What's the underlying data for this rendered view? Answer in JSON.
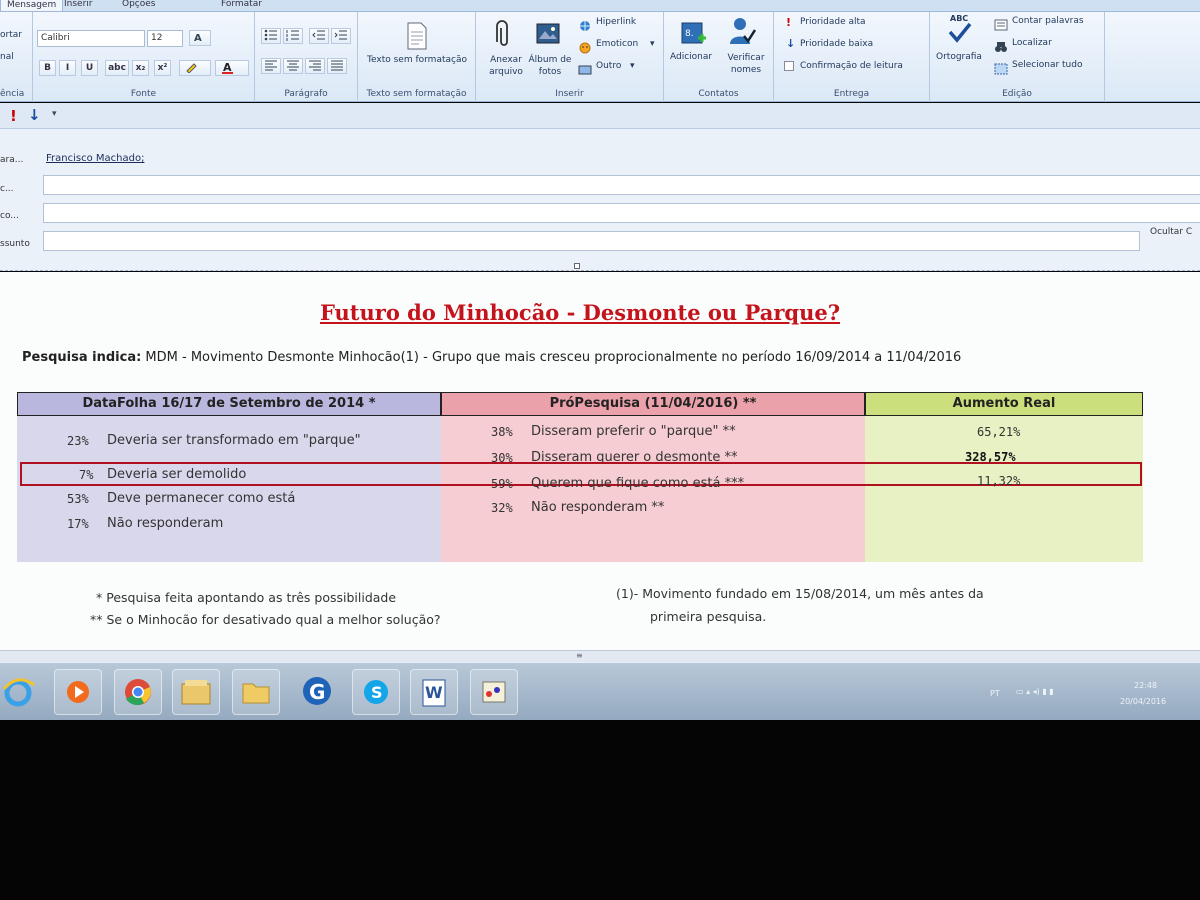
{
  "ribbon": {
    "tabs": [
      "Mensagem",
      "Inserir",
      "Opções",
      "Formatar"
    ],
    "clipboard": {
      "items": [
        "ortar",
        "nal"
      ],
      "group": "ência"
    },
    "font": {
      "name": "Calibri",
      "size": "12",
      "group": "Fonte",
      "buttons": [
        "B",
        "I",
        "U",
        "abc",
        "x₂",
        "x²"
      ]
    },
    "paragraph": {
      "group": "Parágrafo"
    },
    "plain_text": {
      "label": "Texto sem formatação",
      "group": "Texto sem formatação"
    },
    "insert": {
      "attach": "Anexar arquivo",
      "album": "Álbum de fotos",
      "hyperlink": "Hiperlink",
      "emoticon": "Emoticon",
      "other": "Outro",
      "group": "Inserir"
    },
    "contacts": {
      "add": "Adicionar",
      "verify": "Verificar nomes",
      "group": "Contatos"
    },
    "delivery": {
      "high": "Prioridade alta",
      "low": "Prioridade baixa",
      "receipt": "Confirmação de leitura",
      "group": "Entrega"
    },
    "editing": {
      "spelling": "Ortografia",
      "spelling_badge": "ABC",
      "count": "Contar palavras",
      "find": "Localizar",
      "select_all": "Selecionar tudo",
      "group": "Edição"
    }
  },
  "address": {
    "to_label": "ara...",
    "to_value": "Francisco Machado;",
    "cc_label": "c...",
    "cco_label": "co...",
    "subject_label": "ssunto",
    "hide_label": "Ocultar C"
  },
  "message": {
    "title": "Futuro do Minhocão - Desmonte ou Parque?",
    "intro_bold": "Pesquisa indica:",
    "intro_rest": " MDM - Movimento Desmonte Minhocão(1) - Grupo que mais cresceu proprocionalmente no período 16/09/2014 a 11/04/2016",
    "table": {
      "headers": [
        "DataFolha 16/17 de Setembro de 2014 *",
        "PróPesquisa (11/04/2016) **",
        "Aumento Real"
      ],
      "header_colors": [
        "#b9b7de",
        "#eaa1aa",
        "#cbe07c"
      ],
      "body_colors": [
        "#d9d7ec",
        "#f6cdd2",
        "#e7f1c3"
      ],
      "rows": [
        {
          "pct1": "23%",
          "text1": "Deveria ser transformado em \"parque\"",
          "pct2": "38%",
          "text2": "Disseram preferir o \"parque\" **",
          "increase": "65,21%"
        },
        {
          "pct1": "7%",
          "text1": "Deveria ser demolido",
          "pct2": "30%",
          "text2": "Disseram querer o desmonte **",
          "increase": "328,57%"
        },
        {
          "pct1": "53%",
          "text1": "Deve permanecer como está",
          "pct2": "59%",
          "text2": "Querem que fique como está ***",
          "increase": "11,32%"
        },
        {
          "pct1": "17%",
          "text1": "Não responderam",
          "pct2": "32%",
          "text2": "Não responderam **",
          "increase": ""
        }
      ]
    },
    "notes": {
      "n1": "*  Pesquisa feita apontando as três possibilidade",
      "n2": "**  Se o Minhocão for desativado qual a melhor solução?",
      "n3a": "(1)- Movimento fundado em 15/08/2014, um mês antes da",
      "n3b": "primeira pesquisa."
    }
  },
  "taskbar": {
    "apps": [
      "internet-explorer",
      "media-player",
      "chrome",
      "file-explorer",
      "folder",
      "gmail-notifier",
      "skype",
      "word",
      "paint"
    ],
    "tray": {
      "lang": "PT",
      "time": "22:48",
      "date": "20/04/2016"
    }
  }
}
